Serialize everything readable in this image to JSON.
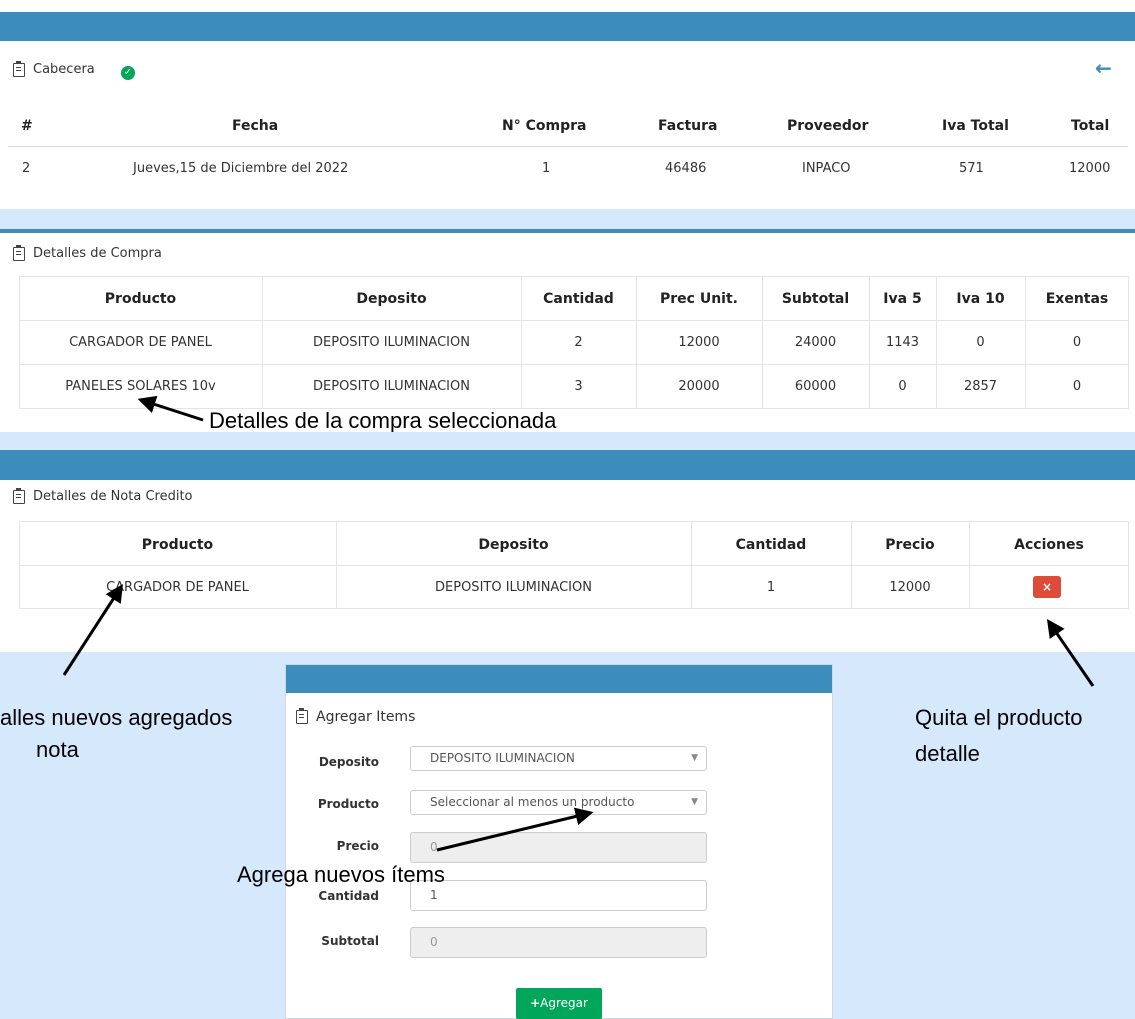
{
  "colors": {
    "header_bar": "#3c8dbc",
    "light_band": "#d6e8fb",
    "success": "#00a65a",
    "danger": "#dd4b39"
  },
  "cabecera": {
    "title": "Cabecera",
    "back_icon": "arrow-left-icon",
    "columns": [
      "#",
      "Fecha",
      "N° Compra",
      "Factura",
      "Proveedor",
      "Iva Total",
      "Total"
    ],
    "row": [
      "2",
      "Jueves,15 de Diciembre del 2022",
      "1",
      "46486",
      "INPACO",
      "571",
      "12000"
    ]
  },
  "detalles_compra": {
    "title": "Detalles de Compra",
    "columns": [
      "Producto",
      "Deposito",
      "Cantidad",
      "Prec Unit.",
      "Subtotal",
      "Iva 5",
      "Iva 10",
      "Exentas"
    ],
    "rows": [
      [
        "CARGADOR DE PANEL",
        "DEPOSITO ILUMINACION",
        "2",
        "12000",
        "24000",
        "1143",
        "0",
        "0"
      ],
      [
        "PANELES SOLARES 10v",
        "DEPOSITO ILUMINACION",
        "3",
        "20000",
        "60000",
        "0",
        "2857",
        "0"
      ]
    ]
  },
  "detalles_nota": {
    "title": "Detalles de Nota Credito",
    "columns": [
      "Producto",
      "Deposito",
      "Cantidad",
      "Precio",
      "Acciones"
    ],
    "rows": [
      [
        "CARGADOR DE PANEL",
        "DEPOSITO ILUMINACION",
        "1",
        "12000"
      ]
    ],
    "delete_label": "×"
  },
  "agregar": {
    "title": "Agregar Items",
    "deposito_label": "Deposito",
    "deposito_value": "DEPOSITO ILUMINACION",
    "producto_label": "Producto",
    "producto_value": "Seleccionar al menos un producto",
    "precio_label": "Precio",
    "precio_value": "0",
    "cantidad_label": "Cantidad",
    "cantidad_value": "1",
    "subtotal_label": "Subtotal",
    "subtotal_value": "0",
    "add_label": "Agregar"
  },
  "annotations": {
    "compra": "Detalles de la compra seleccionada",
    "nuevos_line1": "alles nuevos agregados",
    "nuevos_line2": "nota",
    "agrega": "Agrega nuevos ítems",
    "quita_line1": "Quita el producto",
    "quita_line2": "detalle"
  }
}
